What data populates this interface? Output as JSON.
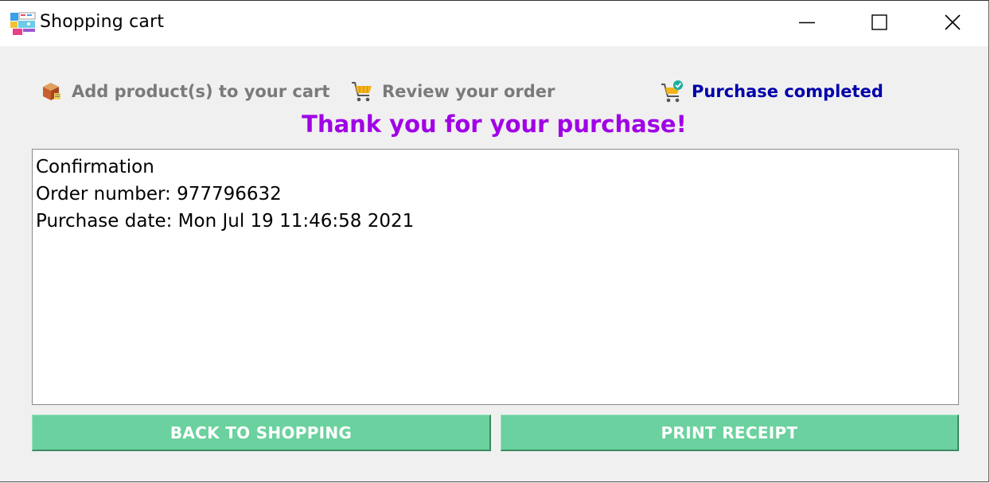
{
  "window": {
    "title": "Shopping cart",
    "app_icon": "shopping-cart-app-icon",
    "controls": {
      "minimize": "minimize-icon",
      "maximize": "maximize-icon",
      "close": "close-icon"
    }
  },
  "steps": [
    {
      "label": "Add product(s) to your cart",
      "icon": "box-icon",
      "active": false
    },
    {
      "label": "Review your order",
      "icon": "cart-icon",
      "active": false
    },
    {
      "label": "Purchase completed",
      "icon": "cart-check-icon",
      "active": true
    }
  ],
  "message": "Thank you for your purchase!",
  "confirmation": {
    "lines": [
      "Confirmation",
      "Order number: 977796632",
      "Purchase date: Mon Jul 19 11:46:58 2021"
    ]
  },
  "buttons": {
    "back": "BACK TO SHOPPING",
    "print": "PRINT RECEIPT"
  },
  "colors": {
    "message": "#a000e6",
    "active_step": "#0000aa",
    "inactive_step": "#7a7a7a",
    "button_bg": "#6bd19e"
  }
}
